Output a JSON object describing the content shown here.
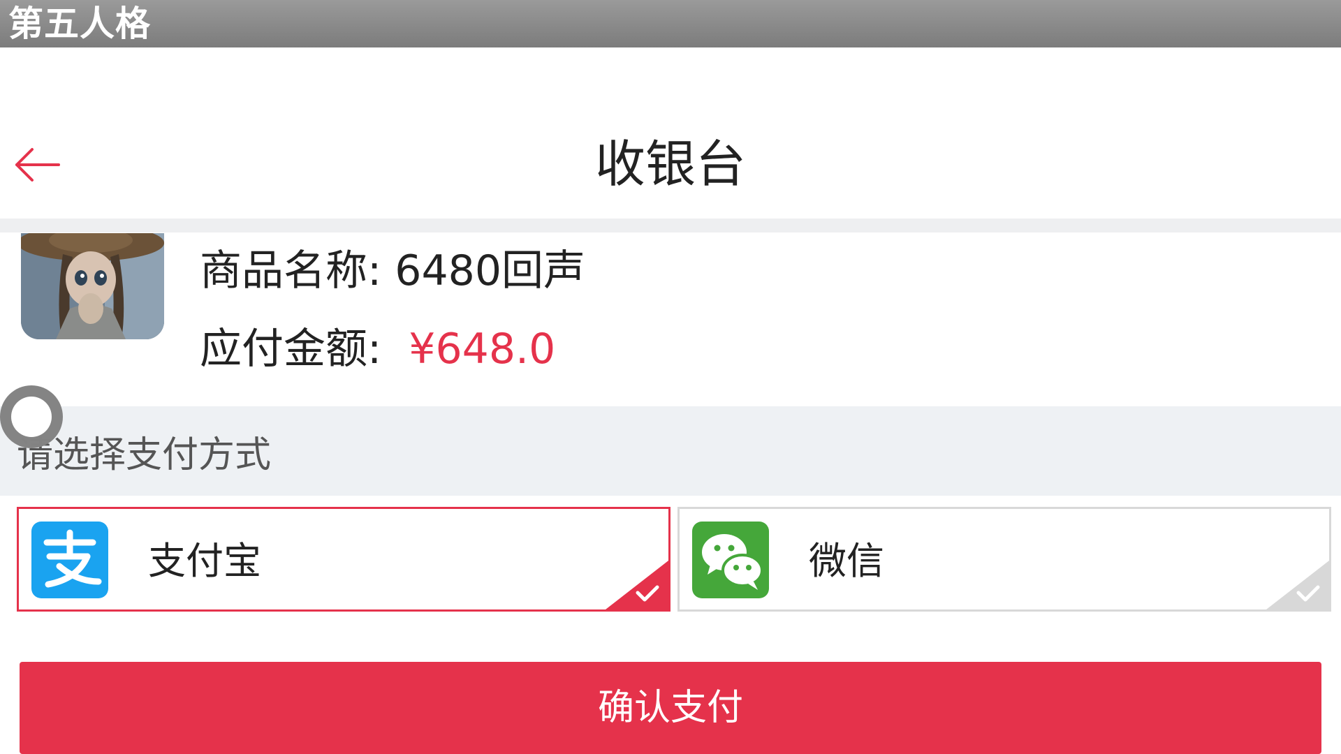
{
  "app": {
    "title": "第五人格"
  },
  "header": {
    "title": "收银台",
    "back_icon": "arrow-left-icon"
  },
  "product": {
    "name_label": "商品名称:",
    "name_value": "6480回声",
    "amount_label": "应付金额:",
    "amount_value": "¥648.0"
  },
  "payment": {
    "section_label": "请选择支付方式",
    "methods": [
      {
        "label": "支付宝",
        "icon": "alipay-icon",
        "selected": true
      },
      {
        "label": "微信",
        "icon": "wechat-icon",
        "selected": false
      }
    ]
  },
  "confirm": {
    "label": "确认支付"
  },
  "colors": {
    "accent": "#e5324b",
    "alipay": "#1aa3f0",
    "wechat": "#45a73a"
  }
}
